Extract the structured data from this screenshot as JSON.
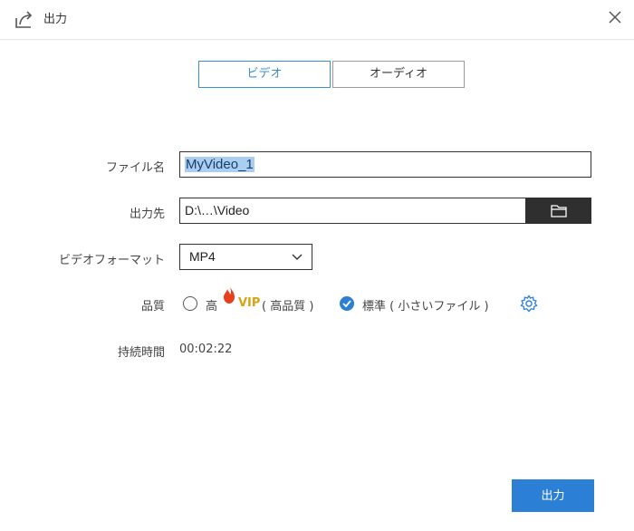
{
  "window": {
    "title": "出力",
    "close_icon": "close-icon",
    "title_icon": "export-icon"
  },
  "tabs": [
    {
      "label": "ビデオ",
      "active": true
    },
    {
      "label": "オーディオ",
      "active": false
    }
  ],
  "fields": {
    "filename": {
      "label": "ファイル名",
      "value": "MyVideo_1"
    },
    "output_path": {
      "label": "出力先",
      "value": "D:\\…\\Video",
      "browse_icon": "folder-icon"
    },
    "format": {
      "label": "ビデオフォーマット",
      "value": "MP4"
    },
    "quality": {
      "label": "品質",
      "options": [
        {
          "prefix": "高",
          "badge": "VIP",
          "suffix": "( 高品質 )",
          "selected": false
        },
        {
          "text": "標準 ( 小さいファイル )",
          "selected": true
        }
      ],
      "settings_icon": "gear-icon"
    },
    "duration": {
      "label": "持続時間",
      "value": "00:02:22"
    }
  },
  "actions": {
    "export_label": "出力"
  },
  "colors": {
    "accent": "#2b7fd4",
    "vip": "#d9a316",
    "flame": "#e8401c"
  }
}
